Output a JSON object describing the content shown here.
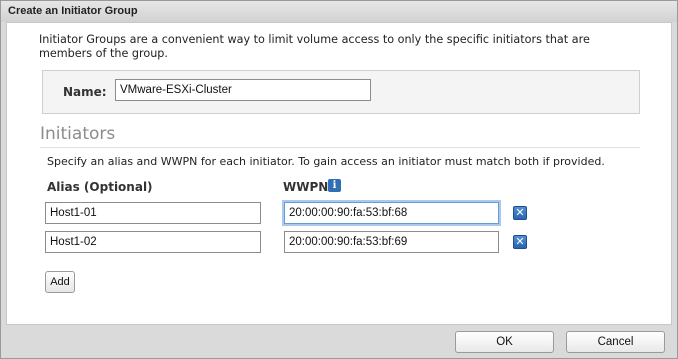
{
  "dialog": {
    "title": "Create an Initiator Group"
  },
  "intro": {
    "text": "Initiator Groups are a convenient way to limit volume access to only the specific initiators that are members of the group."
  },
  "name": {
    "label": "Name:",
    "value": "VMware-ESXi-Cluster"
  },
  "initiators": {
    "title": "Initiators",
    "instructions": "Specify an alias and WWPN for each initiator. To gain access an initiator must match both if provided.",
    "alias_header": "Alias (Optional)",
    "wwpn_header": "WWPN",
    "info_icon": "info-icon",
    "rows": [
      {
        "alias": "Host1-01",
        "wwpn": "20:00:00:90:fa:53:bf:68"
      },
      {
        "alias": "Host1-02",
        "wwpn": "20:00:00:90:fa:53:bf:69"
      }
    ],
    "remove_icon": "remove-icon",
    "add_label": "Add"
  },
  "footer": {
    "ok_label": "OK",
    "cancel_label": "Cancel"
  },
  "colors": {
    "accent": "#2f6fb4",
    "focus_ring": "#a9c9ee"
  }
}
